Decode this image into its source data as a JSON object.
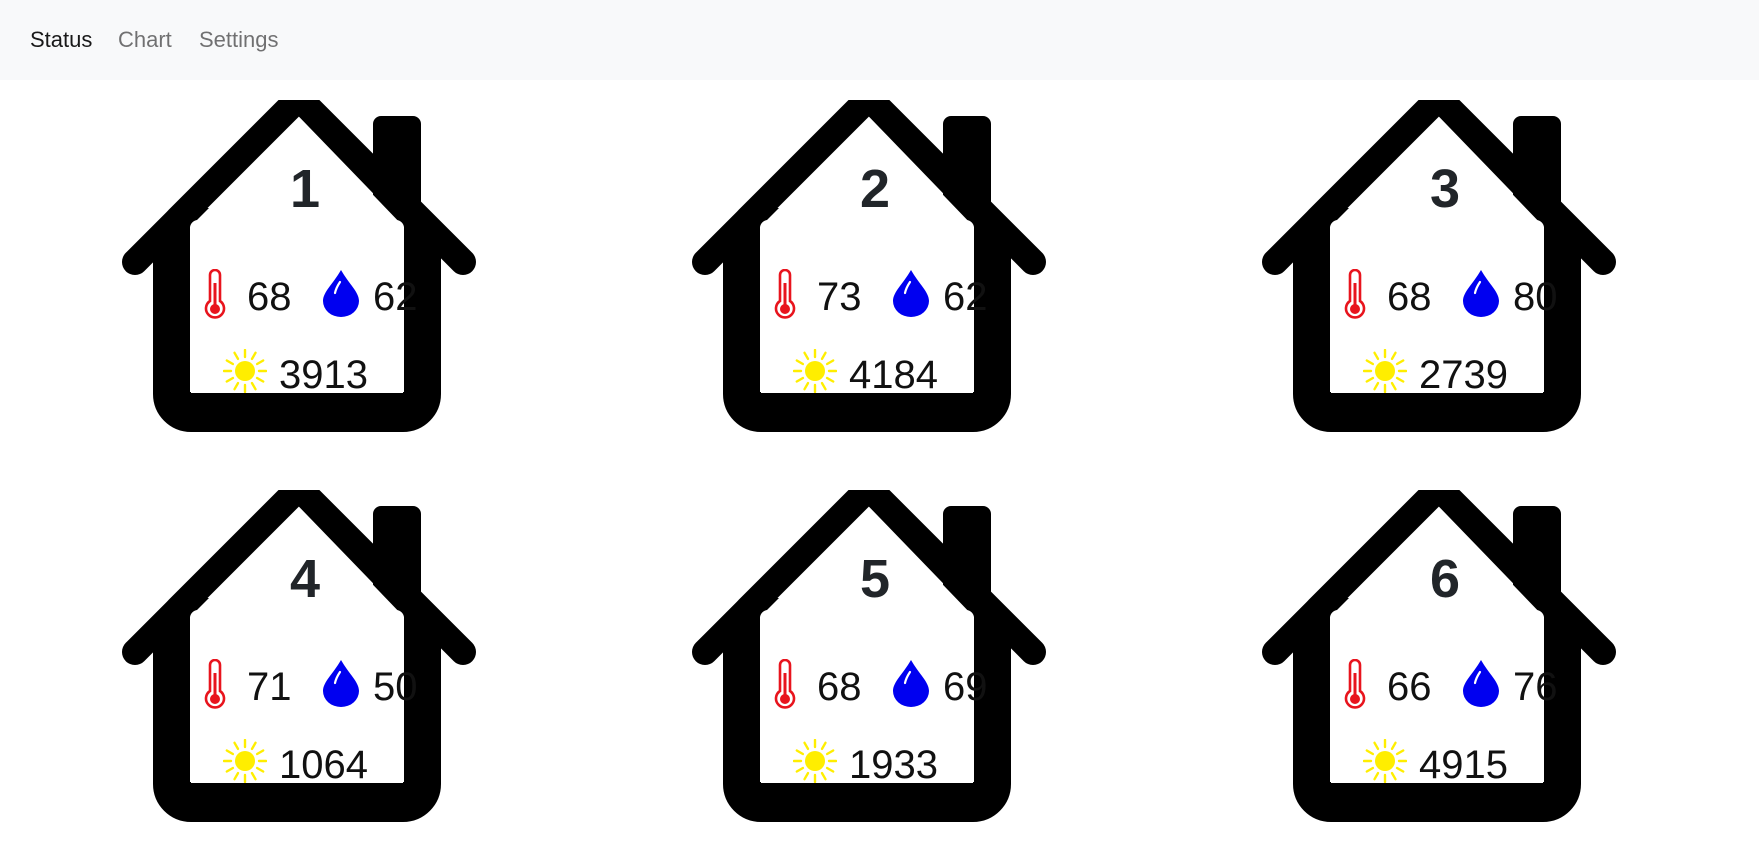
{
  "nav": {
    "items": [
      {
        "label": "Status",
        "active": true
      },
      {
        "label": "Chart",
        "active": false
      },
      {
        "label": "Settings",
        "active": false
      }
    ]
  },
  "colors": {
    "thermometer": "#e8141d",
    "droplet": "#0000f0",
    "sun": "#ffee00",
    "house": "#000000"
  },
  "icons": [
    "thermometer-icon",
    "water-drop-icon",
    "sun-icon",
    "house-icon"
  ],
  "houses": [
    {
      "number": "1",
      "temperature": "68",
      "humidity": "62",
      "light": "3913"
    },
    {
      "number": "2",
      "temperature": "73",
      "humidity": "62",
      "light": "4184"
    },
    {
      "number": "3",
      "temperature": "68",
      "humidity": "80",
      "light": "2739"
    },
    {
      "number": "4",
      "temperature": "71",
      "humidity": "50",
      "light": "1064"
    },
    {
      "number": "5",
      "temperature": "68",
      "humidity": "69",
      "light": "1933"
    },
    {
      "number": "6",
      "temperature": "66",
      "humidity": "76",
      "light": "4915"
    }
  ]
}
